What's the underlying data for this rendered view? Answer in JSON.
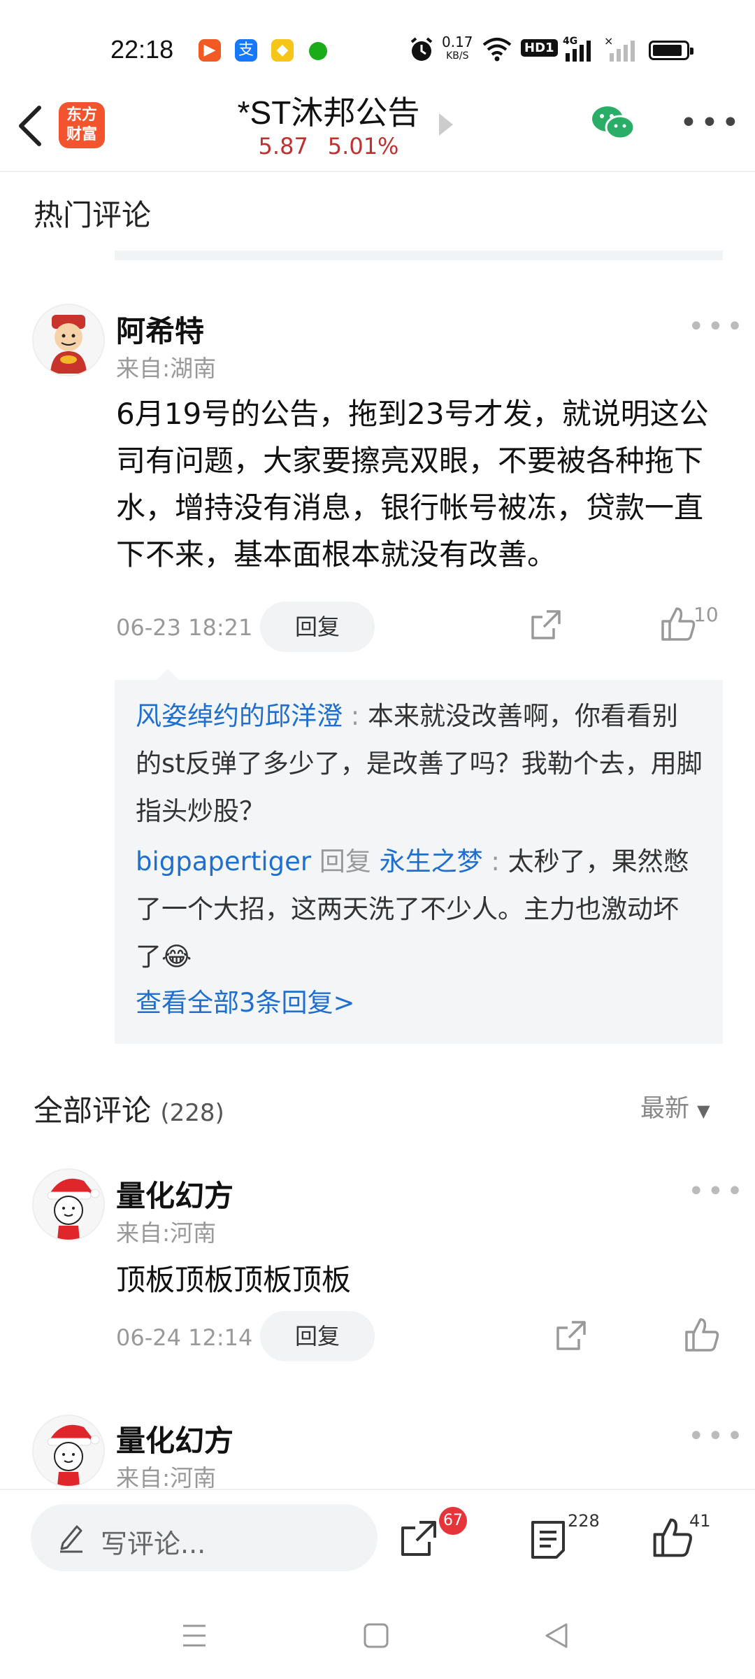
{
  "status_bar": {
    "time": "22:18",
    "net_speed_value": "0.17",
    "net_speed_unit": "KB/S",
    "hd_label": "HD1",
    "network_label": "4G"
  },
  "header": {
    "logo_text": "东方财富",
    "title": "*ST沐邦公告",
    "price": "5.87",
    "change_pct": "5.01%"
  },
  "hot_comments": {
    "section_title": "热门评论",
    "items": [
      {
        "username": "阿希特",
        "location": "来自:湖南",
        "content": "6月19号的公告，拖到23号才发，就说明这公司有问题，大家要擦亮双眼，不要被各种拖下水，增持没有消息，银行帐号被冻，贷款一直下不来，基本面根本就没有改善。",
        "timestamp": "06-23 18:21",
        "reply_label": "回复",
        "like_count": "10",
        "replies": [
          {
            "author": "风姿绰约的邱洋澄",
            "text": "本来就没改善啊，你看看别的st反弹了多少了，是改善了吗？我勒个去，用脚指头炒股？"
          },
          {
            "author": "bigpapertiger",
            "reply_word": "回复",
            "target": "永生之梦",
            "text": "太秒了，果然憋了一个大招，这两天洗了不少人。主力也激动坏了😂"
          }
        ],
        "view_all": "查看全部3条回复>"
      }
    ]
  },
  "all_comments": {
    "section_title": "全部评论",
    "count": "(228)",
    "sort_label": "最新",
    "items": [
      {
        "username": "量化幻方",
        "location": "来自:河南",
        "content": "顶板顶板顶板顶板",
        "timestamp": "06-24 12:14",
        "reply_label": "回复"
      },
      {
        "username": "量化幻方",
        "location": "来自:河南"
      }
    ]
  },
  "bottom_bar": {
    "input_placeholder": "写评论...",
    "share_count": "67",
    "comment_count": "228",
    "like_count": "41"
  },
  "colors": {
    "accent_red": "#c0302e",
    "link_blue": "#1e6fcf",
    "logo_orange": "#f2542d"
  }
}
